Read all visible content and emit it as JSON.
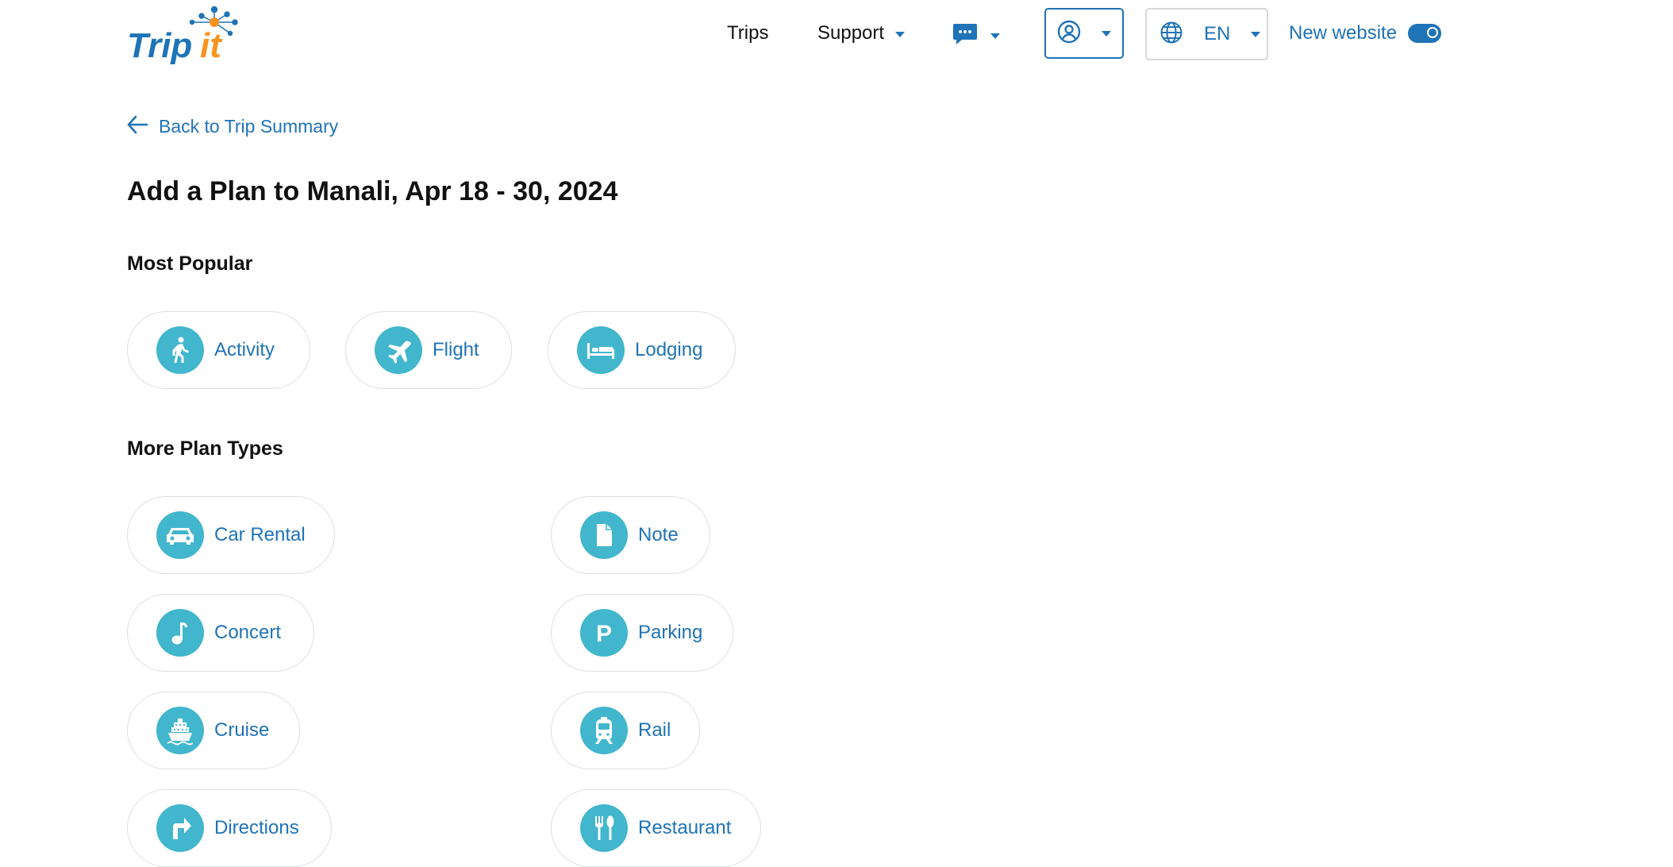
{
  "header": {
    "logo_text": "TripIt",
    "nav": {
      "trips": "Trips",
      "support": "Support"
    },
    "chat_icon": "chat-bubble-icon",
    "account_icon": "user-circle-icon",
    "language": {
      "icon": "globe-icon",
      "code": "EN"
    },
    "new_website": {
      "label": "New website",
      "enabled": true
    }
  },
  "back_link": {
    "label": "Back to Trip Summary",
    "icon": "arrow-left-icon"
  },
  "page_title": "Add a Plan to Manali, Apr 18 - 30, 2024",
  "sections": {
    "most_popular": {
      "title": "Most Popular",
      "items": [
        {
          "label": "Activity",
          "icon": "walking-person-icon"
        },
        {
          "label": "Flight",
          "icon": "airplane-icon"
        },
        {
          "label": "Lodging",
          "icon": "bed-icon"
        }
      ]
    },
    "more_plan_types": {
      "title": "More Plan Types",
      "items": [
        {
          "label": "Car Rental",
          "icon": "car-icon"
        },
        {
          "label": "Note",
          "icon": "document-icon"
        },
        {
          "label": "Concert",
          "icon": "music-note-icon"
        },
        {
          "label": "Parking",
          "icon": "parking-icon"
        },
        {
          "label": "Cruise",
          "icon": "ship-icon"
        },
        {
          "label": "Rail",
          "icon": "train-icon"
        },
        {
          "label": "Directions",
          "icon": "turn-right-arrow-icon"
        },
        {
          "label": "Restaurant",
          "icon": "fork-knife-icon"
        }
      ]
    }
  },
  "colors": {
    "brand_blue": "#1f73b7",
    "icon_teal": "#42b6cd",
    "logo_orange": "#f7941d",
    "pill_border": "#dcdfe3"
  }
}
